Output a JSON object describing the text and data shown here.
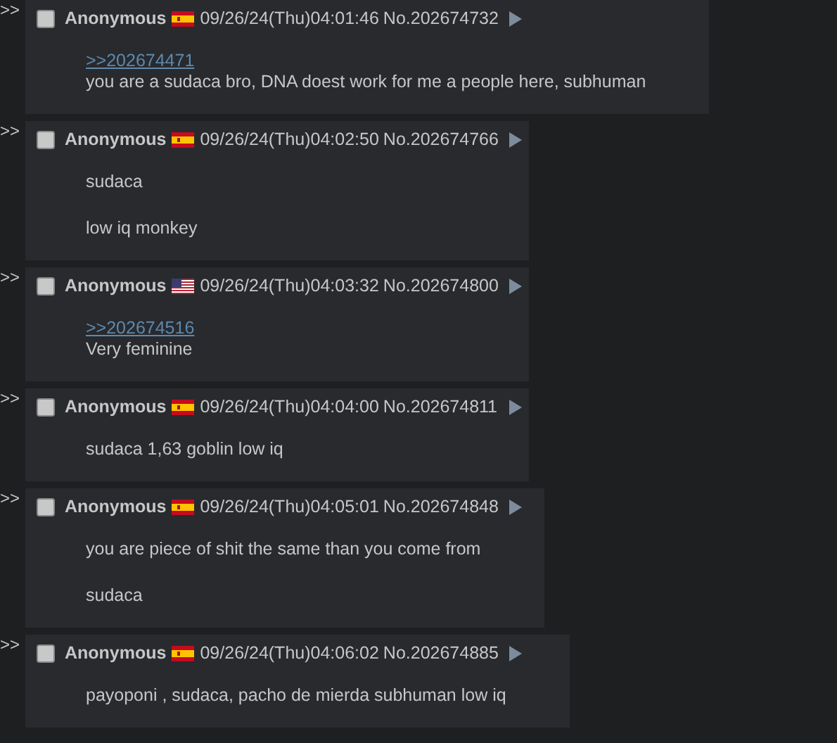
{
  "posts": [
    {
      "arrows": ">>",
      "checked": false,
      "name": "Anonymous",
      "flag": {
        "kind": "spain"
      },
      "date": "09/26/24(Thu)04:01:46",
      "number": "No.202674732",
      "paragraphs": [
        [
          {
            "kind": "quote",
            "text": ">>202674471"
          },
          {
            "kind": "text",
            "text": "you are a sudaca bro, DNA doest work for me a people here, subhuman"
          }
        ]
      ]
    },
    {
      "arrows": ">>",
      "checked": false,
      "name": "Anonymous",
      "flag": {
        "kind": "spain"
      },
      "date": "09/26/24(Thu)04:02:50",
      "number": "No.202674766",
      "paragraphs": [
        [
          {
            "kind": "text",
            "text": "sudaca"
          }
        ],
        [
          {
            "kind": "text",
            "text": "low iq monkey"
          }
        ]
      ]
    },
    {
      "arrows": ">>",
      "checked": false,
      "name": "Anonymous",
      "flag": {
        "kind": "stripes"
      },
      "date": "09/26/24(Thu)04:03:32",
      "number": "No.202674800",
      "paragraphs": [
        [
          {
            "kind": "quote",
            "text": ">>202674516"
          },
          {
            "kind": "text",
            "text": "Very feminine"
          }
        ]
      ]
    },
    {
      "arrows": ">>",
      "checked": false,
      "name": "Anonymous",
      "flag": {
        "kind": "spain"
      },
      "date": "09/26/24(Thu)04:04:00",
      "number": "No.202674811",
      "paragraphs": [
        [
          {
            "kind": "text",
            "text": "sudaca 1,63 goblin low iq"
          }
        ]
      ]
    },
    {
      "arrows": ">>",
      "checked": false,
      "name": "Anonymous",
      "flag": {
        "kind": "spain"
      },
      "date": "09/26/24(Thu)04:05:01",
      "number": "No.202674848",
      "paragraphs": [
        [
          {
            "kind": "text",
            "text": "you are piece of shit the same than you come from"
          }
        ],
        [
          {
            "kind": "text",
            "text": "sudaca"
          }
        ]
      ]
    },
    {
      "arrows": ">>",
      "checked": false,
      "name": "Anonymous",
      "flag": {
        "kind": "spain"
      },
      "date": "09/26/24(Thu)04:06:02",
      "number": "No.202674885",
      "paragraphs": [
        [
          {
            "kind": "text",
            "text": "payoponi , sudaca, pacho de mierda subhuman low iq"
          }
        ]
      ]
    }
  ]
}
